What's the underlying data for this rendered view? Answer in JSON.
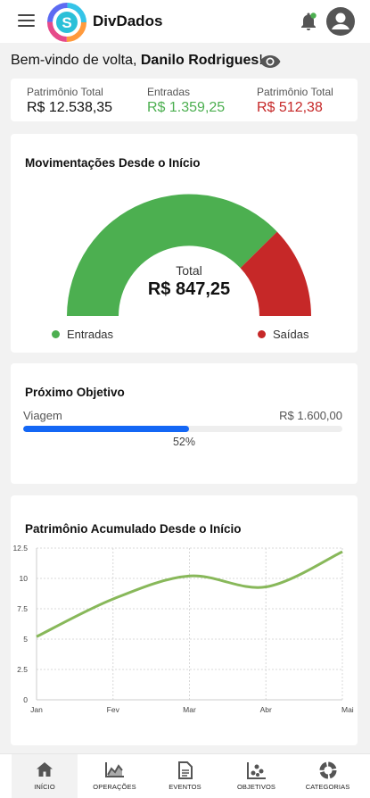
{
  "app": {
    "title": "DivDados"
  },
  "welcome": {
    "prefix": "Bem-vindo de volta, ",
    "name": "Danilo Rodrigues",
    "suffix": "!"
  },
  "summary": [
    {
      "label": "Patrimônio Total",
      "value": "R$ 12.538,35",
      "color": "#111111"
    },
    {
      "label": "Entradas",
      "value": "R$ 1.359,25",
      "color": "#4caf50"
    },
    {
      "label": "Patrimônio Total",
      "value": "R$ 512,38",
      "color": "#c62828"
    }
  ],
  "movements": {
    "title": "Movimentações Desde o Início",
    "center_label": "Total",
    "center_value": "R$ 847,25",
    "legend": [
      {
        "label": "Entradas",
        "color": "#4caf50"
      },
      {
        "label": "Saídas",
        "color": "#c62828"
      }
    ]
  },
  "goal": {
    "title": "Próximo Objetivo",
    "name": "Viagem",
    "target": "R$ 1.600,00",
    "percent_label": "52%",
    "progress": 0.52,
    "bar_color": "#1467f5"
  },
  "chart_data": {
    "type": "line",
    "title": "Patrimônio Acumulado Desde o Início",
    "categories": [
      "Jan",
      "Fev",
      "Mar",
      "Abr",
      "Mai"
    ],
    "series": [
      {
        "values": [
          5.2,
          8.3,
          10.2,
          9.3,
          12.2
        ],
        "color": "#88b85a"
      }
    ],
    "ylim": [
      0,
      12.5
    ],
    "yticks": [
      "0",
      "2.5",
      "5",
      "7.5",
      "10",
      "12.5"
    ],
    "grid": true
  },
  "nav": [
    {
      "label": "INÍCIO",
      "icon": "home-icon",
      "active": true
    },
    {
      "label": "OPERAÇÕES",
      "icon": "chart-icon",
      "active": false
    },
    {
      "label": "EVENTOS",
      "icon": "document-icon",
      "active": false
    },
    {
      "label": "OBJETIVOS",
      "icon": "scatter-icon",
      "active": false
    },
    {
      "label": "CATEGORIAS",
      "icon": "donut-icon",
      "active": false
    }
  ]
}
